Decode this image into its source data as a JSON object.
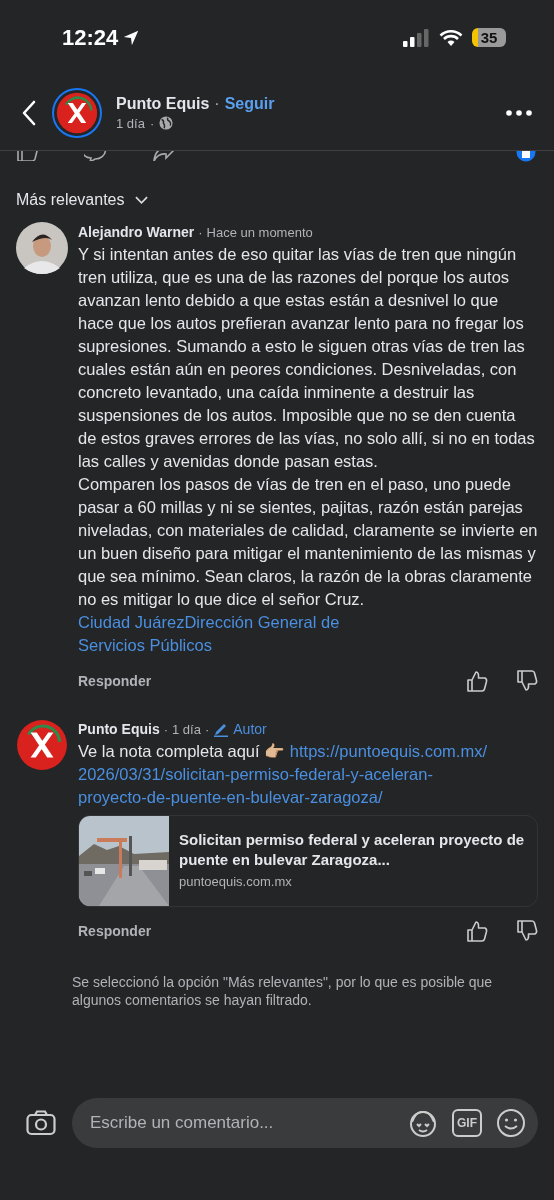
{
  "status_bar": {
    "time": "12:24",
    "battery": "35"
  },
  "header": {
    "page_name": "Punto Equis",
    "separator": "·",
    "follow": "Seguir",
    "time": "1 día",
    "time_separator": "·"
  },
  "sort": {
    "label": "Más relevantes"
  },
  "comments": [
    {
      "kind": "user",
      "author": "Alejandro Warner",
      "separator": "·",
      "time": "Hace un momento",
      "text": "Y si intentan antes de eso quitar las vías de tren que ningún tren utiliza, que es una de las razones del porque los autos avanzan lento debido a que estas están a desnivel lo que hace que los autos prefieran avanzar lento para no fregar los supresiones. Sumando a esto le siguen otras vías de tren las cuales están aún en peores condiciones. Desniveladas, con concreto levantado, una caída inminente a destruir las suspensiones de los autos. Imposible que no se den cuenta de estos graves errores de las vías, no solo allí, si no en todas las calles y avenidas donde pasan estas.\nComparen los pasos de vías de tren en el paso, uno puede pasar a 60 millas y ni se sientes, pajitas, razón están parejas niveladas, con materiales de calidad, claramente se invierte en un buen diseño para mitigar el mantenimiento de las mismas y que sea mínimo. Sean claros, la razón de la obras claramente no es mitigar lo que dice el señor Cruz.",
      "link_lines": [
        "Ciudad JuárezDirección General de",
        "Servicios Públicos"
      ],
      "reply": "Responder"
    },
    {
      "kind": "page",
      "author": "Punto Equis",
      "separator": "·",
      "time": "1 día",
      "badge_separator": "·",
      "badge": "Autor",
      "text": "Ve la nota completa aquí 👉🏼",
      "link_lines": [
        "https://puntoequis.com.mx/",
        "2026/03/31/solicitan-permiso-federal-y-aceleran-",
        "proyecto-de-puente-en-bulevar-zaragoza/"
      ],
      "preview": {
        "title": "Solicitan permiso federal y aceleran proyecto de puente en bulevar Zaragoza...",
        "domain": "puntoequis.com.mx"
      },
      "reply": "Responder"
    }
  ],
  "footnote": "Se seleccionó la opción \"Más relevantes\", por lo que es posible que algunos comentarios se hayan filtrado.",
  "composer": {
    "placeholder": "Escribe un comentario...",
    "gif": "GIF"
  }
}
